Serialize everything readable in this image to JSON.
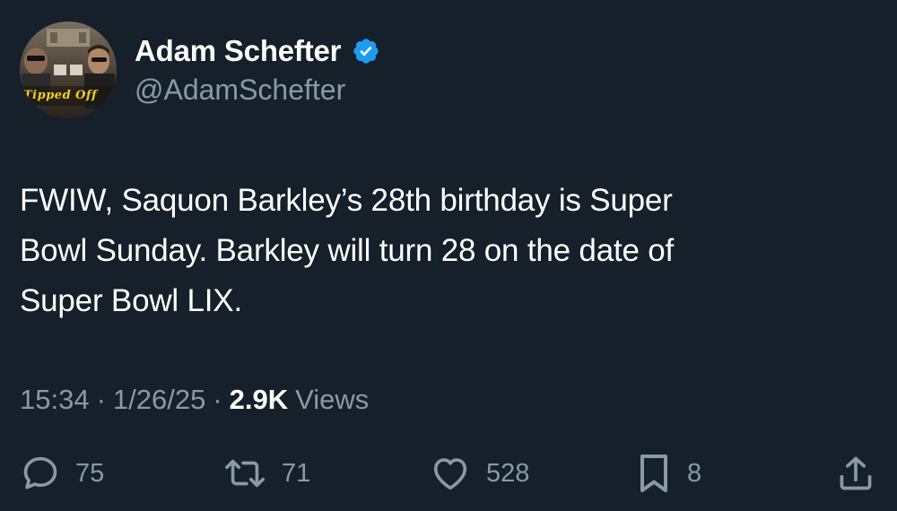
{
  "tweet": {
    "display_name": "Adam Schefter",
    "handle": "@AdamSchefter",
    "avatar_text": "Tipped Off",
    "text": "FWIW, Saquon Barkley’s 28th birthday is Super\nBowl Sunday. Barkley will turn 28 on the date of\nSuper Bowl LIX.",
    "time": "15:34",
    "date": "1/26/25",
    "views_count": "2.9K",
    "views_label": "Views",
    "separator": "·"
  },
  "actions": {
    "replies": "75",
    "reposts": "71",
    "likes": "528",
    "bookmarks": "8"
  },
  "colors": {
    "background": "#15202b",
    "text_primary": "#ffffff",
    "text_secondary": "#8b98a5",
    "verified_blue": "#1d9bf0",
    "avatar_text": "#f2d216"
  },
  "icons": {
    "verified": "verified-badge-icon",
    "reply": "reply-icon",
    "repost": "repost-icon",
    "like": "heart-icon",
    "bookmark": "bookmark-icon",
    "share": "share-icon"
  }
}
